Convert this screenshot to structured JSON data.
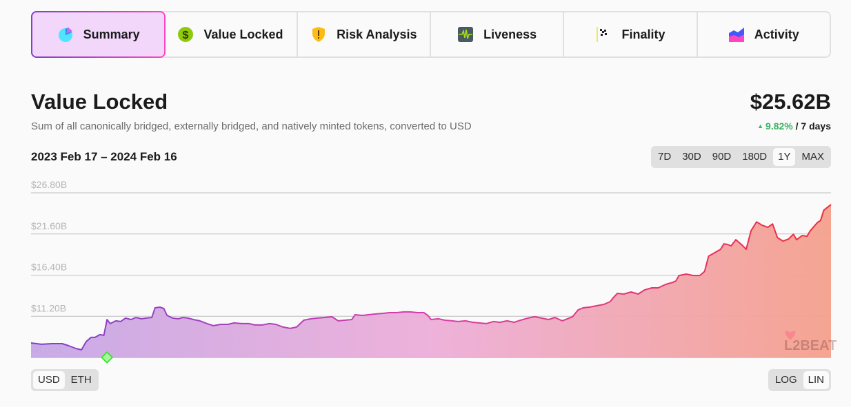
{
  "tabs": [
    {
      "label": "Summary",
      "icon": "pie-chart-icon",
      "active": true
    },
    {
      "label": "Value Locked",
      "icon": "dollar-coin-icon",
      "active": false
    },
    {
      "label": "Risk Analysis",
      "icon": "shield-warning-icon",
      "active": false
    },
    {
      "label": "Liveness",
      "icon": "heartbeat-icon",
      "active": false
    },
    {
      "label": "Finality",
      "icon": "checkered-flag-icon",
      "active": false
    },
    {
      "label": "Activity",
      "icon": "area-chart-icon",
      "active": false
    }
  ],
  "header": {
    "title": "Value Locked",
    "subtitle": "Sum of all canonically bridged, externally bridged, and natively minted tokens, converted to USD",
    "total": "$25.62B",
    "change_arrow": "▲",
    "change_pct": "9.82%",
    "change_period": " / 7 days",
    "date_range": "2023 Feb 17 – 2024 Feb 16"
  },
  "time_ranges": [
    {
      "label": "7D",
      "selected": false
    },
    {
      "label": "30D",
      "selected": false
    },
    {
      "label": "90D",
      "selected": false
    },
    {
      "label": "180D",
      "selected": false
    },
    {
      "label": "1Y",
      "selected": true
    },
    {
      "label": "MAX",
      "selected": false
    }
  ],
  "currency": [
    {
      "label": "USD",
      "selected": true
    },
    {
      "label": "ETH",
      "selected": false
    }
  ],
  "scale": [
    {
      "label": "LOG",
      "selected": false
    },
    {
      "label": "LIN",
      "selected": true
    }
  ],
  "watermark": "L2BEAT",
  "colors": {
    "line_start": "#7e41cc",
    "line_mid": "#d63fa9",
    "line_end": "#ee2c3c",
    "milestone": "#3be32b",
    "positive": "#3bb263"
  },
  "chart_data": {
    "type": "area",
    "title": "Value Locked",
    "xlabel": "",
    "ylabel": "",
    "x_start": "2023-02-17",
    "x_end": "2024-02-16",
    "ylim": [
      6.0,
      26.8
    ],
    "yticks": [
      "$6.00B",
      "$11.20B",
      "$16.40B",
      "$21.60B",
      "$26.80B"
    ],
    "ytick_values": [
      6.0,
      11.2,
      16.4,
      21.6,
      26.8
    ],
    "grid": true,
    "legend": "none",
    "unit": "USD billions",
    "milestone_fraction": 0.095,
    "series": [
      {
        "name": "Value Locked",
        "x_fraction": [
          0,
          0.013,
          0.026,
          0.039,
          0.047,
          0.056,
          0.063,
          0.069,
          0.075,
          0.08,
          0.086,
          0.091,
          0.095,
          0.099,
          0.106,
          0.112,
          0.118,
          0.125,
          0.131,
          0.138,
          0.144,
          0.151,
          0.155,
          0.161,
          0.166,
          0.17,
          0.177,
          0.184,
          0.19,
          0.196,
          0.203,
          0.211,
          0.22,
          0.228,
          0.237,
          0.246,
          0.254,
          0.263,
          0.272,
          0.28,
          0.289,
          0.298,
          0.306,
          0.315,
          0.324,
          0.332,
          0.341,
          0.35,
          0.358,
          0.367,
          0.376,
          0.384,
          0.393,
          0.401,
          0.405,
          0.414,
          0.422,
          0.431,
          0.44,
          0.448,
          0.457,
          0.466,
          0.474,
          0.483,
          0.491,
          0.496,
          0.5,
          0.509,
          0.517,
          0.526,
          0.534,
          0.543,
          0.552,
          0.56,
          0.569,
          0.578,
          0.586,
          0.595,
          0.604,
          0.612,
          0.621,
          0.63,
          0.638,
          0.647,
          0.655,
          0.664,
          0.677,
          0.684,
          0.69,
          0.698,
          0.707,
          0.716,
          0.724,
          0.728,
          0.733,
          0.741,
          0.75,
          0.759,
          0.767,
          0.776,
          0.784,
          0.793,
          0.802,
          0.806,
          0.81,
          0.819,
          0.828,
          0.836,
          0.842,
          0.847,
          0.853,
          0.862,
          0.866,
          0.871,
          0.875,
          0.881,
          0.888,
          0.894,
          0.9,
          0.907,
          0.914,
          0.921,
          0.927,
          0.933,
          0.94,
          0.947,
          0.953,
          0.957,
          0.964,
          0.97,
          0.974,
          0.983,
          0.987,
          0.991,
          1.0
        ],
        "values": [
          7.83,
          7.66,
          7.74,
          7.74,
          7.48,
          7.13,
          6.96,
          8.0,
          8.53,
          8.53,
          8.88,
          8.79,
          10.79,
          10.27,
          10.62,
          10.53,
          10.97,
          10.79,
          11.05,
          10.88,
          10.97,
          11.05,
          12.27,
          12.35,
          12.18,
          11.31,
          10.97,
          10.88,
          11.05,
          10.97,
          10.79,
          10.62,
          10.27,
          10.01,
          10.18,
          10.18,
          10.36,
          10.27,
          10.27,
          10.1,
          10.1,
          10.27,
          10.18,
          9.84,
          9.66,
          9.84,
          10.71,
          10.88,
          10.97,
          11.05,
          11.14,
          10.62,
          10.71,
          10.79,
          11.4,
          11.31,
          11.4,
          11.49,
          11.57,
          11.66,
          11.66,
          11.75,
          11.75,
          11.66,
          11.66,
          11.31,
          10.79,
          10.88,
          10.71,
          10.62,
          10.53,
          10.62,
          10.44,
          10.36,
          10.27,
          10.53,
          10.44,
          10.62,
          10.44,
          10.71,
          10.97,
          11.14,
          10.97,
          10.79,
          11.05,
          10.62,
          11.14,
          12.01,
          12.27,
          12.35,
          12.53,
          12.7,
          13.05,
          13.57,
          14.09,
          14.01,
          14.27,
          14.01,
          14.53,
          14.79,
          14.79,
          15.22,
          15.48,
          15.66,
          16.35,
          16.53,
          16.35,
          16.35,
          16.87,
          18.79,
          19.14,
          19.66,
          20.35,
          20.27,
          20.09,
          20.87,
          20.27,
          19.66,
          22.0,
          23.13,
          22.7,
          22.44,
          22.87,
          21.14,
          20.7,
          20.96,
          21.57,
          20.87,
          21.4,
          21.31,
          22.0,
          23.05,
          23.31,
          24.61,
          25.31,
          25.48
        ]
      }
    ]
  }
}
